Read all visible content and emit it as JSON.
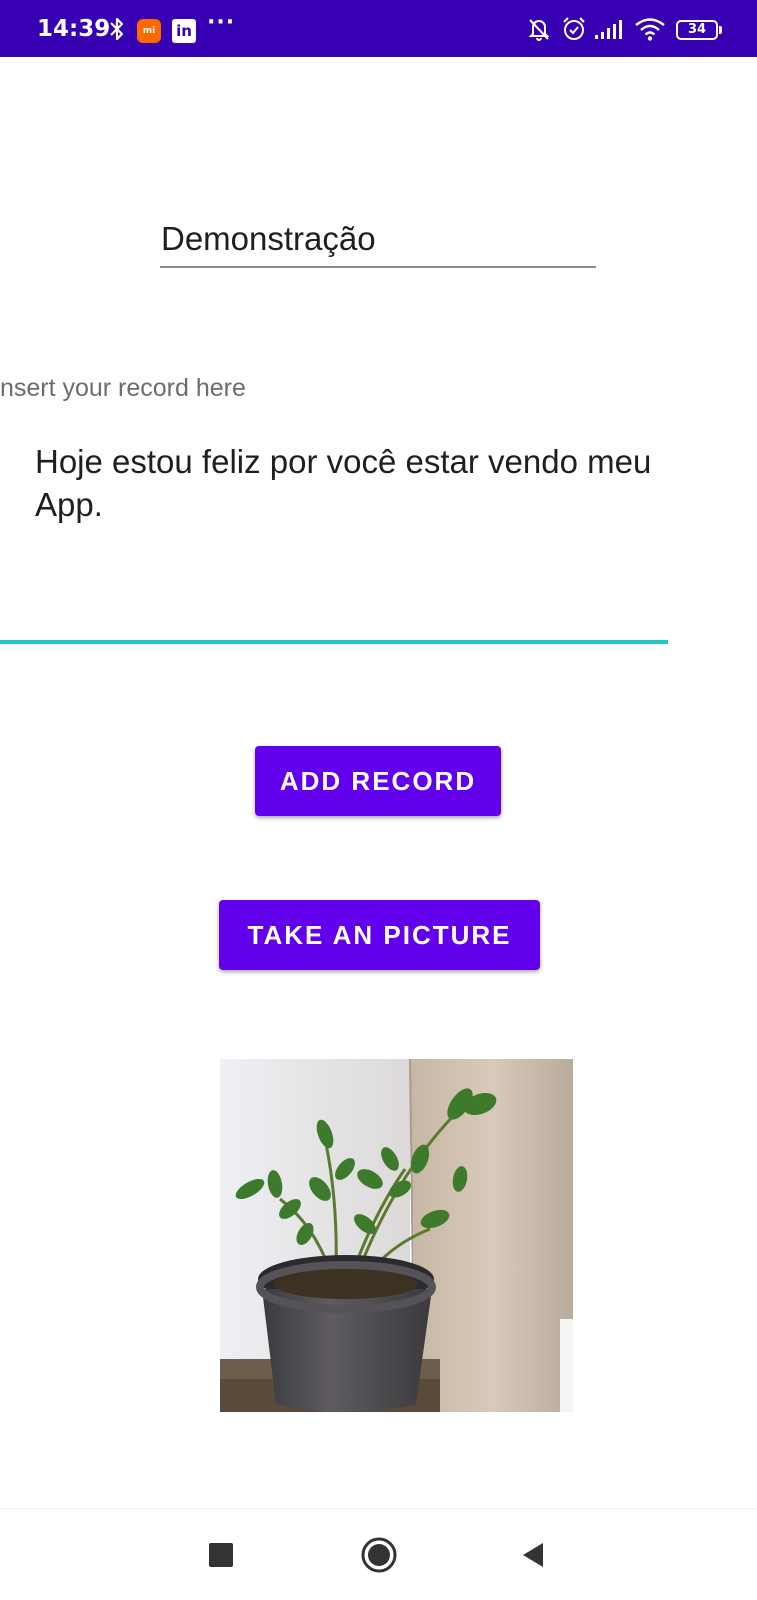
{
  "status_bar": {
    "time": "14:39",
    "battery": "34",
    "colors": {
      "background": "#3700b3",
      "foreground": "#ffffff"
    },
    "icons": [
      "bluetooth-icon",
      "mi-app-icon",
      "linkedin-icon",
      "more-notifications-icon",
      "silent-bell-icon",
      "alarm-icon",
      "signal-icon",
      "wifi-icon",
      "battery-icon"
    ],
    "mi_icon_text": "mi",
    "linkedin_icon_text": "in",
    "more_text": "···"
  },
  "form": {
    "title_value": "Demonstração",
    "record_label": "Insert your record here",
    "record_value": "Hoje estou feliz por você estar vendo meu App.",
    "accent_color": "#1fc9c6"
  },
  "buttons": {
    "add_record": "ADD RECORD",
    "take_picture": "TAKE AN PICTURE",
    "color": "#6200ee"
  },
  "photo": {
    "subject": "potted-plant-photo"
  },
  "navigation": {
    "icons": [
      "recents-square-icon",
      "home-circle-icon",
      "back-triangle-icon"
    ]
  }
}
